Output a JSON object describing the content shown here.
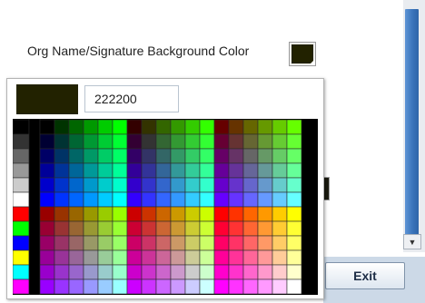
{
  "field_label": "Org Name/Signature Background Color",
  "current_color": "#222200",
  "picker": {
    "hex_value": "222200",
    "preview_color": "#222200"
  },
  "exit_label": "Exit",
  "icons": {
    "scroll_down": "chevron-down-icon"
  },
  "colors": {
    "scroll_accent": "#3a74bb",
    "panel_bg": "#ccd9e7"
  }
}
